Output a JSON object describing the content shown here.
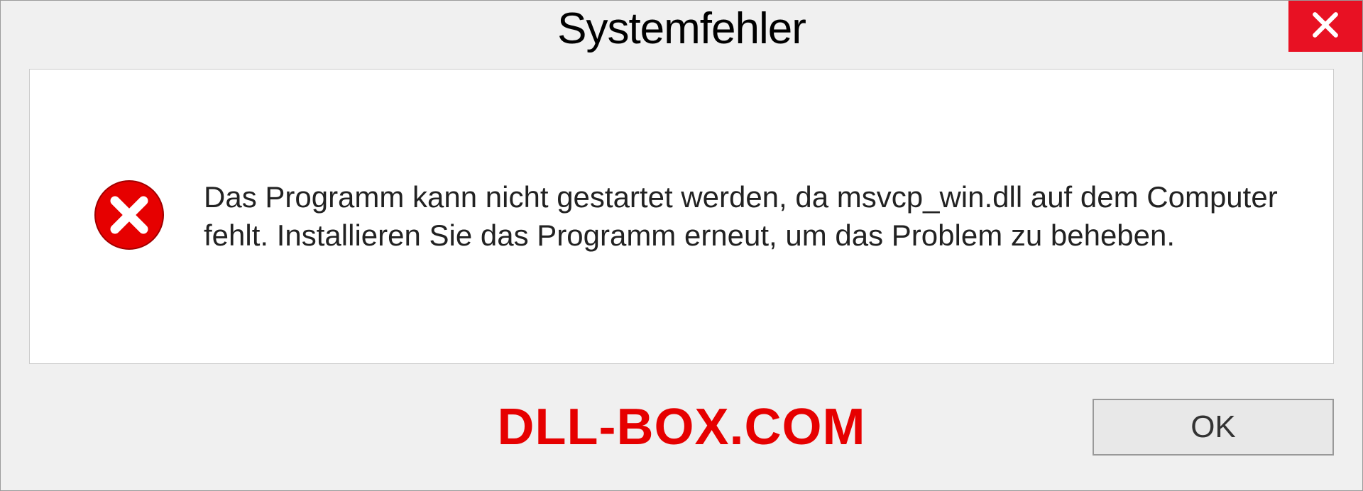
{
  "dialog": {
    "title": "Systemfehler",
    "message": "Das Programm kann nicht gestartet werden, da msvcp_win.dll auf dem Computer fehlt. Installieren Sie das Programm erneut, um das Problem zu beheben.",
    "ok_label": "OK",
    "watermark": "DLL-BOX.COM"
  }
}
